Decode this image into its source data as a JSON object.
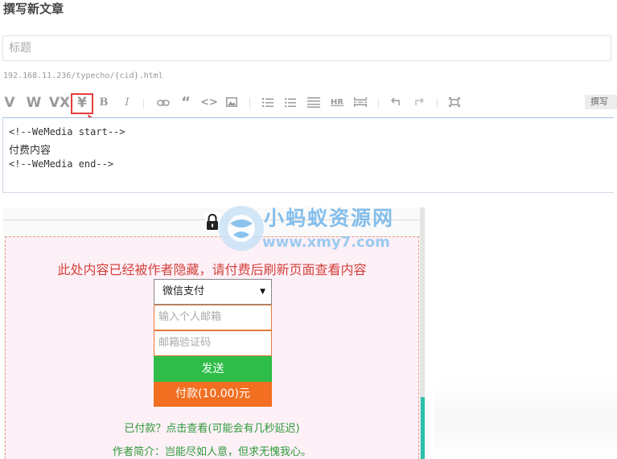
{
  "page": {
    "title": "撰写新文章"
  },
  "title_field": {
    "placeholder": "标题"
  },
  "permalink": "192.168.11.236/typecho/{cid}.html",
  "toolbar": {
    "v_label": "V",
    "w_label": "W",
    "vx_label": "VX",
    "yen_label": "¥",
    "bold_label": "B",
    "italic_label": "I",
    "quote_label": "“",
    "code_label": "<>",
    "hr_label": "HR",
    "preview_label": "撰写"
  },
  "editor": {
    "lines": [
      "<!--WeMedia start-->",
      "付费内容",
      "<!--WeMedia end-->"
    ]
  },
  "preview": {
    "hidden_message": "此处内容已经被作者隐藏，请付费后刷新页面查看内容",
    "payment_method": "微信支付",
    "email_placeholder": "输入个人邮箱",
    "code_placeholder": "邮箱验证码",
    "send_label": "发送",
    "pay_label": "付款(10.00)元",
    "paid_link": "已付款？点击查看(可能会有几秒延迟)",
    "author_intro": "作者简介：岂能尽如人意，但求无愧我心。"
  },
  "watermark": {
    "name": "小蚂蚁资源网",
    "url": "www.xmy7.com"
  },
  "colors": {
    "send": "#2ebd48",
    "pay": "#f26f22",
    "message": "#d4423b",
    "highlight": "#e43d3d"
  }
}
